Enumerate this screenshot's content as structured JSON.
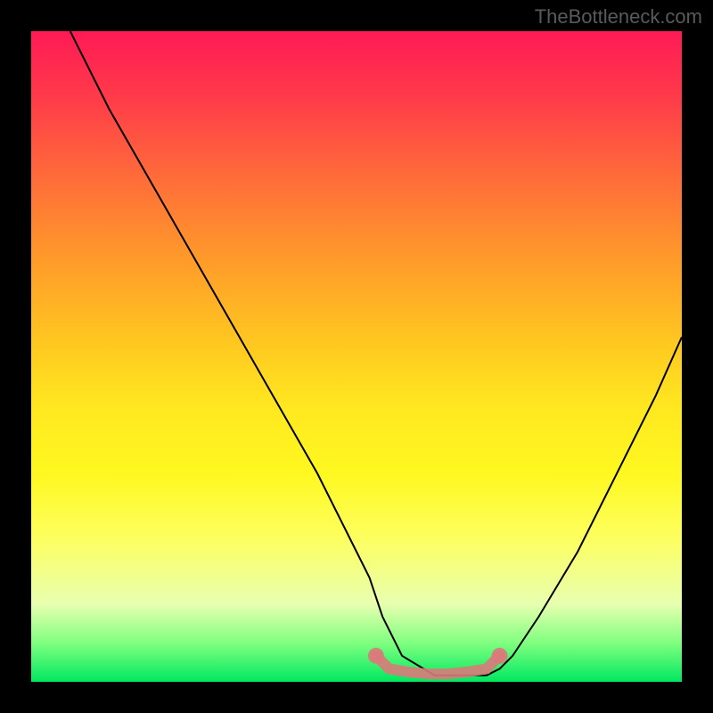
{
  "watermark": "TheBottleneck.com",
  "chart_data": {
    "type": "line",
    "title": "",
    "xlabel": "",
    "ylabel": "",
    "xlim": [
      0,
      100
    ],
    "ylim": [
      0,
      100
    ],
    "series": [
      {
        "name": "bottleneck-curve",
        "x": [
          6,
          12,
          20,
          28,
          36,
          44,
          52,
          54,
          57,
          62,
          67,
          70,
          72,
          74,
          78,
          84,
          90,
          96,
          100
        ],
        "y": [
          100,
          88,
          74,
          60,
          46,
          32,
          16,
          10,
          4,
          1,
          1,
          1,
          2,
          4,
          10,
          20,
          32,
          44,
          53
        ]
      },
      {
        "name": "marker-band",
        "x": [
          53,
          55,
          58,
          61,
          64,
          67,
          70,
          72
        ],
        "y": [
          4,
          2,
          1.5,
          1.2,
          1.2,
          1.5,
          2,
          4
        ]
      }
    ],
    "colors": {
      "curve": "#000000",
      "markers": "#d97a7a"
    }
  }
}
